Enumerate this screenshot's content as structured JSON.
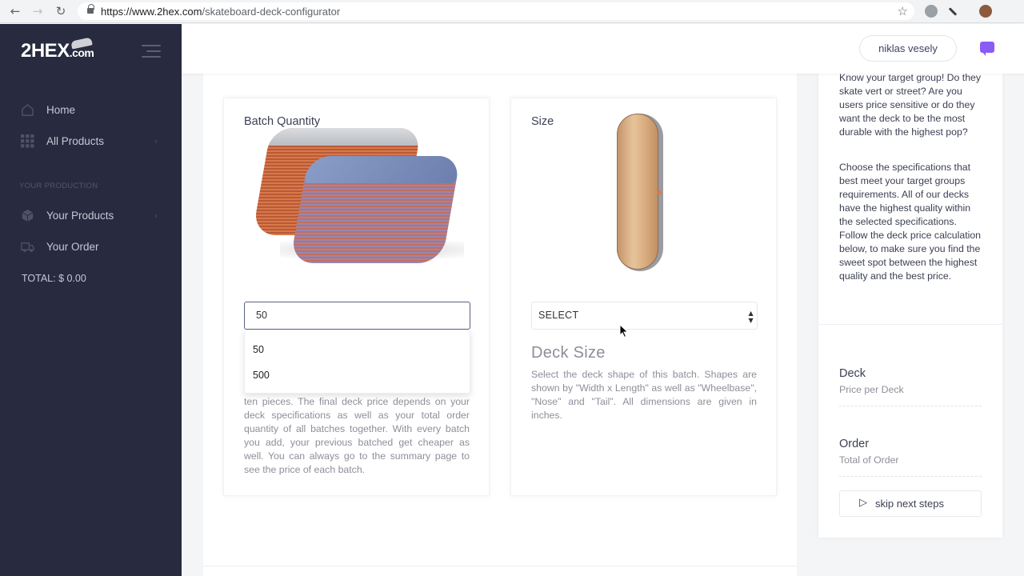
{
  "browser": {
    "url_host": "https://www.2hex.com",
    "url_path": "/skateboard-deck-configurator"
  },
  "sidebar": {
    "logo": "2HEX",
    "logo_suffix": ".com",
    "items": [
      {
        "label": "Home",
        "icon": "home-icon"
      },
      {
        "label": "All Products",
        "icon": "grid-icon",
        "arrow": "›"
      },
      {
        "label": "Your Products",
        "icon": "cube-icon",
        "arrow": "›"
      },
      {
        "label": "Your Order",
        "icon": "truck-icon"
      }
    ],
    "section_label": "YOUR PRODUCTION",
    "total": "TOTAL: $ 0.00"
  },
  "header": {
    "user_name": "niklas vesely"
  },
  "batch_card": {
    "title": "Batch Quantity",
    "input_value": "50",
    "options": [
      "50",
      "500"
    ],
    "description": "ten pieces. The final deck price depends on your deck specifications as well as your total order quantity of all batches together. With every batch you add, your previous batched get cheaper as well. You can always go to the summary page to see the price of each batch."
  },
  "size_card": {
    "title": "Size",
    "select_value": "SELECT",
    "heading": "Deck Size",
    "description": "Select the deck shape of this batch. Shapes are shown by \"Width x Length\" as well as \"Wheelbase\", \"Nose\" and \"Tail\". All dimensions are given in inches."
  },
  "right_panel": {
    "text1": "Know your target group! Do they skate vert or street? Are you users price sensitive or do they want the deck to be the most durable with the highest pop?",
    "text2": "Choose the specifications that best meet your target groups requirements. All of our decks have the highest quality within the selected specifications. Follow the deck price calculation below, to make sure you find the sweet spot between the highest quality and the best price.",
    "deck_title": "Deck",
    "deck_sub": "Price per Deck",
    "order_title": "Order",
    "order_sub": "Total of Order",
    "skip_label": "skip next steps"
  },
  "colors": {
    "sidebar_bg": "#282b3f",
    "accent": "#8a5cf6"
  }
}
